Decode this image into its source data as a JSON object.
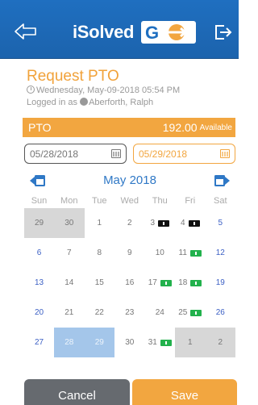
{
  "header": {
    "brand_text": "iSolved",
    "brand_go": "GO",
    "back_icon": "back-arrow-icon",
    "logout_icon": "logout-icon"
  },
  "request": {
    "title": "Request PTO",
    "datetime": "Wednesday, May-09-2018 05:54 PM",
    "logged_in_prefix": "Logged in as",
    "user": "Aberforth, Ralph"
  },
  "pto": {
    "label": "PTO",
    "value": "192.00",
    "available_label": "Available"
  },
  "dates": {
    "start": "05/28/2018",
    "end": "05/29/2018"
  },
  "calendar": {
    "month_label": "May 2018",
    "days_of_week": [
      "Sun",
      "Mon",
      "Tue",
      "Wed",
      "Thu",
      "Fri",
      "Sat"
    ],
    "weeks": [
      [
        "29",
        "30",
        "1",
        "2",
        "3",
        "4",
        "5"
      ],
      [
        "6",
        "7",
        "8",
        "9",
        "10",
        "11",
        "12"
      ],
      [
        "13",
        "14",
        "15",
        "16",
        "17",
        "18",
        "19"
      ],
      [
        "20",
        "21",
        "22",
        "23",
        "24",
        "25",
        "26"
      ],
      [
        "27",
        "28",
        "29",
        "30",
        "31",
        "1",
        "2"
      ]
    ]
  },
  "actions": {
    "cancel": "Cancel",
    "save": "Save"
  },
  "colors": {
    "header_blue": "#1f6fc0",
    "accent_orange": "#f2a640",
    "weekend_blue": "#3b5fc4",
    "selected_range": "#a4c6ea",
    "badge_green": "#22b14c"
  }
}
